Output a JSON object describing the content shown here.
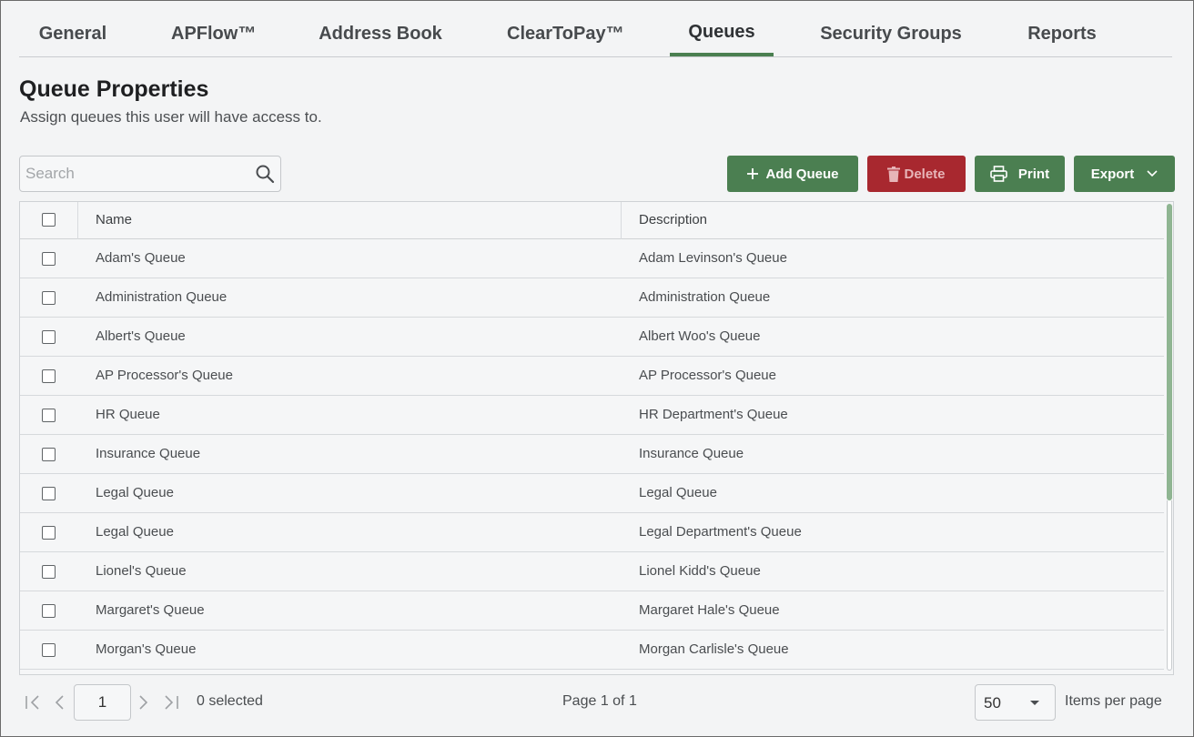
{
  "tabs": [
    {
      "label": "General",
      "active": false
    },
    {
      "label": "APFlow™",
      "active": false
    },
    {
      "label": "Address Book",
      "active": false
    },
    {
      "label": "ClearToPay™",
      "active": false
    },
    {
      "label": "Queues",
      "active": true
    },
    {
      "label": "Security Groups",
      "active": false
    },
    {
      "label": "Reports",
      "active": false
    }
  ],
  "page": {
    "title": "Queue Properties",
    "subtitle": "Assign queues this user will have access to."
  },
  "search": {
    "placeholder": "Search",
    "value": "",
    "icon": "search-icon"
  },
  "toolbar": {
    "add_label": "Add Queue",
    "delete_label": "Delete",
    "print_label": "Print",
    "export_label": "Export"
  },
  "table": {
    "columns": [
      "Name",
      "Description"
    ],
    "rows": [
      {
        "name": "Adam's Queue",
        "description": "Adam Levinson's Queue"
      },
      {
        "name": "Administration Queue",
        "description": "Administration Queue"
      },
      {
        "name": "Albert's Queue",
        "description": "Albert Woo's Queue"
      },
      {
        "name": "AP Processor's Queue",
        "description": "AP Processor's Queue"
      },
      {
        "name": "HR Queue",
        "description": "HR Department's Queue"
      },
      {
        "name": "Insurance Queue",
        "description": "Insurance Queue"
      },
      {
        "name": "Legal Queue",
        "description": "Legal Queue"
      },
      {
        "name": "Legal Queue",
        "description": "Legal Department's Queue"
      },
      {
        "name": "Lionel's Queue",
        "description": "Lionel Kidd's Queue"
      },
      {
        "name": "Margaret's Queue",
        "description": "Margaret Hale's Queue"
      },
      {
        "name": "Morgan's Queue",
        "description": "Morgan Carlisle's Queue"
      }
    ]
  },
  "pager": {
    "current_page": "1",
    "selected_text": "0 selected",
    "page_info": "Page 1 of 1",
    "per_page": "50",
    "per_page_label": "Items per page"
  },
  "colors": {
    "accent_green": "#4b7f51",
    "danger_red": "#a8282f",
    "background": "#f3f4f5"
  }
}
